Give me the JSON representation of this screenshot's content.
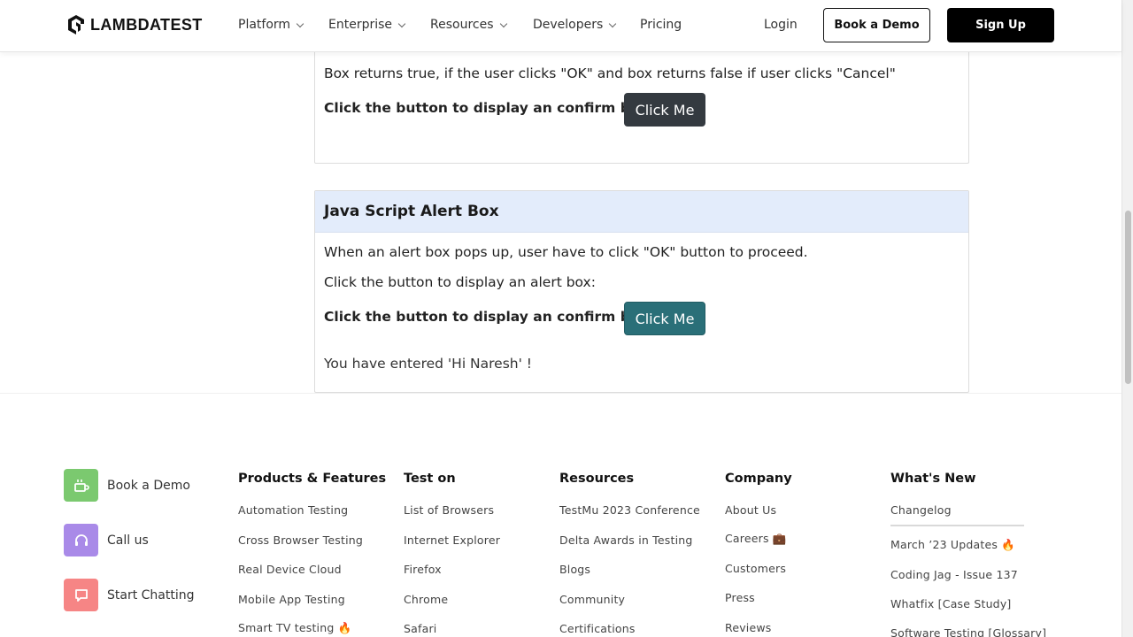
{
  "nav": {
    "logo": "LAMBDATEST",
    "items": [
      {
        "label": "Platform"
      },
      {
        "label": "Enterprise"
      },
      {
        "label": "Resources"
      },
      {
        "label": "Developers"
      },
      {
        "label": "Pricing"
      }
    ],
    "login": "Login",
    "book_demo": "Book a Demo",
    "signup": "Sign Up"
  },
  "confirm_section": {
    "description": "Box returns true, if the user clicks \"OK\" and box returns false if user clicks \"Cancel\"",
    "prompt": "Click the button to display an confirm box:",
    "button": "Click Me"
  },
  "alert_section": {
    "title": "Java Script Alert Box",
    "description": "When an alert box pops up, user have to click \"OK\" button to proceed.",
    "instruction": "Click the button to display an alert box:",
    "prompt": "Click the button to display an confirm box:",
    "button": "Click Me",
    "result": "You have entered 'Hi Naresh' !"
  },
  "footer": {
    "contacts": [
      {
        "label": "Book a Demo",
        "icon": "demo-icon",
        "color": "#7bc96f"
      },
      {
        "label": "Call us",
        "icon": "headset-icon",
        "color": "#a98ae8"
      },
      {
        "label": "Start Chatting",
        "icon": "chat-icon",
        "color": "#f68585"
      }
    ],
    "columns": [
      {
        "title": "Products & Features",
        "links": [
          "Automation Testing",
          "Cross Browser Testing",
          "Real Device Cloud",
          "Mobile App Testing",
          "Smart TV testing 🔥"
        ]
      },
      {
        "title": "Test on",
        "links": [
          "List of Browsers",
          "Internet Explorer",
          "Firefox",
          "Chrome",
          "Safari"
        ]
      },
      {
        "title": "Resources",
        "links": [
          "TestMu 2023 Conference",
          "Delta Awards in Testing",
          "Blogs",
          "Community",
          "Certifications"
        ]
      },
      {
        "title": "Company",
        "links": [
          "About Us",
          "Careers 💼",
          "Customers",
          "Press",
          "Reviews"
        ]
      },
      {
        "title": "What's New",
        "links": [
          "Changelog",
          "March ’23 Updates 🔥",
          "Coding Jag - Issue 137",
          "Whatfix [Case Study]",
          "Software Testing [Glossary]"
        ]
      }
    ]
  }
}
